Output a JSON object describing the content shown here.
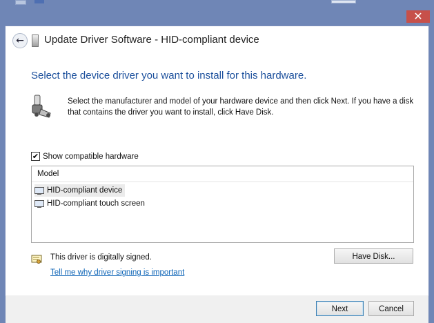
{
  "window": {
    "title": "Update Driver Software - HID-compliant device",
    "close_glyph": "✕",
    "back_glyph": "←",
    "accent_color": "#6f86b6"
  },
  "main": {
    "heading": "Select the device driver you want to install for this hardware.",
    "instructions": "Select the manufacturer and model of your hardware device and then click Next. If you have a disk that contains the driver you want to install, click Have Disk.",
    "show_compatible": {
      "label": "Show compatible hardware",
      "checked": true,
      "check_glyph": "✔"
    },
    "model_list": {
      "header": "Model",
      "items": [
        {
          "label": "HID-compliant device",
          "selected": true
        },
        {
          "label": "HID-compliant touch screen",
          "selected": false
        }
      ]
    },
    "signed_text": "This driver is digitally signed.",
    "signing_link": "Tell me why driver signing is important",
    "have_disk_label": "Have Disk..."
  },
  "footer": {
    "next_label": "Next",
    "cancel_label": "Cancel"
  }
}
